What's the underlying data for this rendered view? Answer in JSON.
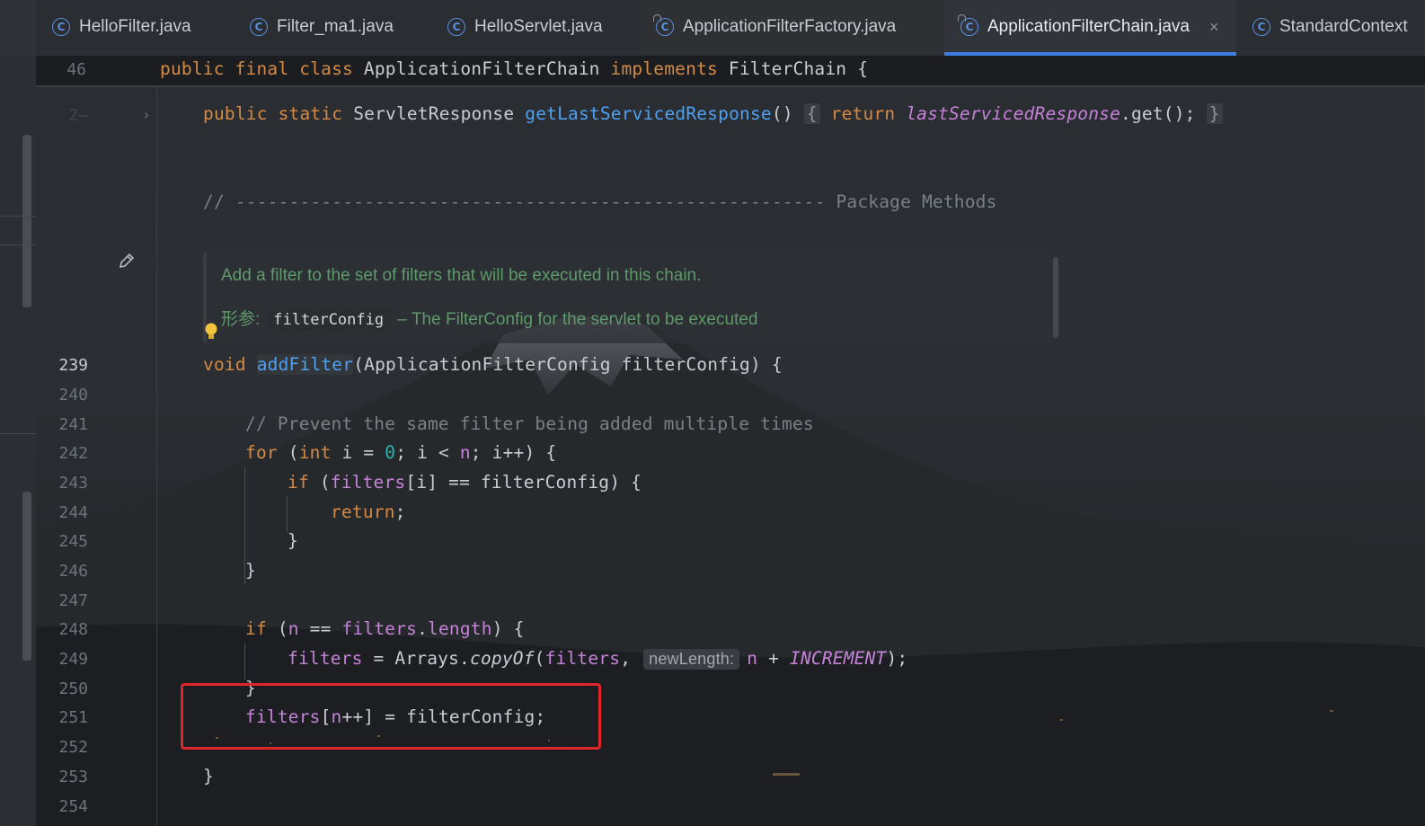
{
  "tabs": [
    {
      "label": "HelloFilter.java",
      "icon": "class-icon"
    },
    {
      "label": "Filter_ma1.java",
      "icon": "class-icon"
    },
    {
      "label": "HelloServlet.java",
      "icon": "class-icon"
    },
    {
      "label": "ApplicationFilterFactory.java",
      "icon": "locked-class-icon"
    },
    {
      "label": "ApplicationFilterChain.java",
      "icon": "locked-class-icon",
      "active": true,
      "close": "×"
    },
    {
      "label": "StandardContext",
      "icon": "class-icon"
    }
  ],
  "sticky_header": {
    "line_number": "46",
    "parts": [
      "public",
      "final",
      "class",
      "ApplicationFilterChain",
      "implements",
      "FilterChain",
      "{"
    ]
  },
  "editor": {
    "folded_method": {
      "kw1": "public",
      "kw2": "static",
      "type": "ServletResponse",
      "name": "getLastServicedResponse",
      "parens": "()",
      "open": "{",
      "ret_kw": "return",
      "field": "lastServicedResponse",
      "call": ".get();",
      "close": "}"
    },
    "section_comment": "// ------------------------------------------------------- Package Methods",
    "doc": {
      "summary": "Add a filter to the set of filters that will be executed in this chain.",
      "param_label": "形参:",
      "param_name": "filterConfig",
      "param_desc": "– The FilterConfig for the servlet to be executed"
    },
    "lines": [
      {
        "n": "239"
      },
      {
        "n": "240"
      },
      {
        "n": "241"
      },
      {
        "n": "242"
      },
      {
        "n": "243"
      },
      {
        "n": "244"
      },
      {
        "n": "245"
      },
      {
        "n": "246"
      },
      {
        "n": "247"
      },
      {
        "n": "248"
      },
      {
        "n": "249"
      },
      {
        "n": "250"
      },
      {
        "n": "251"
      },
      {
        "n": "252"
      },
      {
        "n": "253"
      },
      {
        "n": "254"
      }
    ],
    "code": {
      "l239": {
        "kw": "void",
        "name": "addFilter",
        "rest": "(ApplicationFilterConfig filterConfig) {"
      },
      "l241": "// Prevent the same filter being added multiple times",
      "l242": {
        "kw": "for",
        "a": " (",
        "kw2": "int",
        "b": " i = ",
        "zero": "0",
        "c": "; i < ",
        "n": "n",
        "d": "; i++) {"
      },
      "l243": {
        "kw": "if",
        "a": " (",
        "fld": "filters",
        "b": "[i] == filterConfig) {"
      },
      "l244": {
        "kw": "return",
        "b": ";"
      },
      "l245": "}",
      "l246": "}",
      "l248": {
        "kw": "if",
        "a": " (",
        "n": "n",
        "b": " == ",
        "fld": "filters",
        "c": ".",
        "fld2": "length",
        "d": ") {"
      },
      "l249": {
        "fld": "filters",
        "a": " = Arrays.",
        "m": "copyOf",
        "b": "(",
        "fld2": "filters",
        "c": ",",
        "hint": "newLength:",
        "n": "n",
        "d": " + ",
        "const": "INCREMENT",
        "e": ");"
      },
      "l250": "}",
      "l251": {
        "fld": "filters",
        "a": "[",
        "n": "n",
        "b": "++] = filterConfig;"
      },
      "l253": "}"
    }
  },
  "colors": {
    "accent": "#3d7de0",
    "keyword": "#d48a46",
    "method": "#4fa0f0",
    "field": "#c582d9",
    "highlight_box": "#e0262b"
  }
}
